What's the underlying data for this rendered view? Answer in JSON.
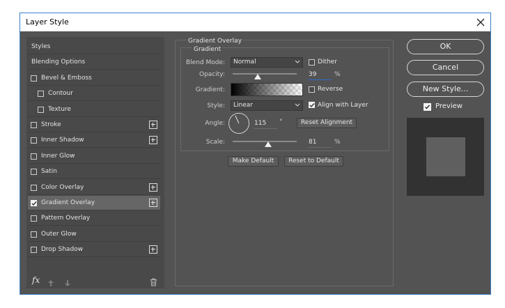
{
  "window": {
    "title": "Layer Style",
    "close_icon": "close-icon"
  },
  "styles_list": {
    "items": [
      {
        "label": "Styles",
        "checkbox": false,
        "checked": false,
        "plus": false,
        "indent": 0,
        "selected": false
      },
      {
        "label": "Blending Options",
        "checkbox": false,
        "checked": false,
        "plus": false,
        "indent": 0,
        "selected": false
      },
      {
        "label": "Bevel & Emboss",
        "checkbox": true,
        "checked": false,
        "plus": false,
        "indent": 0,
        "selected": false
      },
      {
        "label": "Contour",
        "checkbox": true,
        "checked": false,
        "plus": false,
        "indent": 1,
        "selected": false
      },
      {
        "label": "Texture",
        "checkbox": true,
        "checked": false,
        "plus": false,
        "indent": 1,
        "selected": false
      },
      {
        "label": "Stroke",
        "checkbox": true,
        "checked": false,
        "plus": true,
        "indent": 0,
        "selected": false
      },
      {
        "label": "Inner Shadow",
        "checkbox": true,
        "checked": false,
        "plus": true,
        "indent": 0,
        "selected": false
      },
      {
        "label": "Inner Glow",
        "checkbox": true,
        "checked": false,
        "plus": false,
        "indent": 0,
        "selected": false
      },
      {
        "label": "Satin",
        "checkbox": true,
        "checked": false,
        "plus": false,
        "indent": 0,
        "selected": false
      },
      {
        "label": "Color Overlay",
        "checkbox": true,
        "checked": false,
        "plus": true,
        "indent": 0,
        "selected": false
      },
      {
        "label": "Gradient Overlay",
        "checkbox": true,
        "checked": true,
        "plus": true,
        "indent": 0,
        "selected": true
      },
      {
        "label": "Pattern Overlay",
        "checkbox": true,
        "checked": false,
        "plus": false,
        "indent": 0,
        "selected": false
      },
      {
        "label": "Outer Glow",
        "checkbox": true,
        "checked": false,
        "plus": false,
        "indent": 0,
        "selected": false
      },
      {
        "label": "Drop Shadow",
        "checkbox": true,
        "checked": false,
        "plus": true,
        "indent": 0,
        "selected": false
      }
    ],
    "fx_label": "fx"
  },
  "gradient_overlay": {
    "group_title": "Gradient Overlay",
    "sub_title": "Gradient",
    "blend_mode_label": "Blend Mode:",
    "blend_mode_value": "Normal",
    "dither_label": "Dither",
    "dither_checked": false,
    "opacity_label": "Opacity:",
    "opacity_value": "39",
    "opacity_level": 0.39,
    "opacity_unit": "%",
    "gradient_label": "Gradient:",
    "reverse_label": "Reverse",
    "reverse_checked": false,
    "style_label": "Style:",
    "style_value": "Linear",
    "align_label": "Align with Layer",
    "align_checked": true,
    "angle_label": "Angle:",
    "angle_value": "115",
    "angle_degrees": 115,
    "angle_unit": "°",
    "reset_alignment_label": "Reset Alignment",
    "scale_label": "Scale:",
    "scale_value": "81",
    "scale_level": 0.55,
    "scale_unit": "%",
    "make_default_label": "Make Default",
    "reset_default_label": "Reset to Default"
  },
  "actions": {
    "ok_label": "OK",
    "cancel_label": "Cancel",
    "new_style_label": "New Style...",
    "preview_label": "Preview",
    "preview_checked": true
  },
  "colors": {
    "dialog_bg": "#535353",
    "frame_border": "#3a7fc9",
    "selection": "#666666",
    "accent_line": "#2f6fc8"
  }
}
